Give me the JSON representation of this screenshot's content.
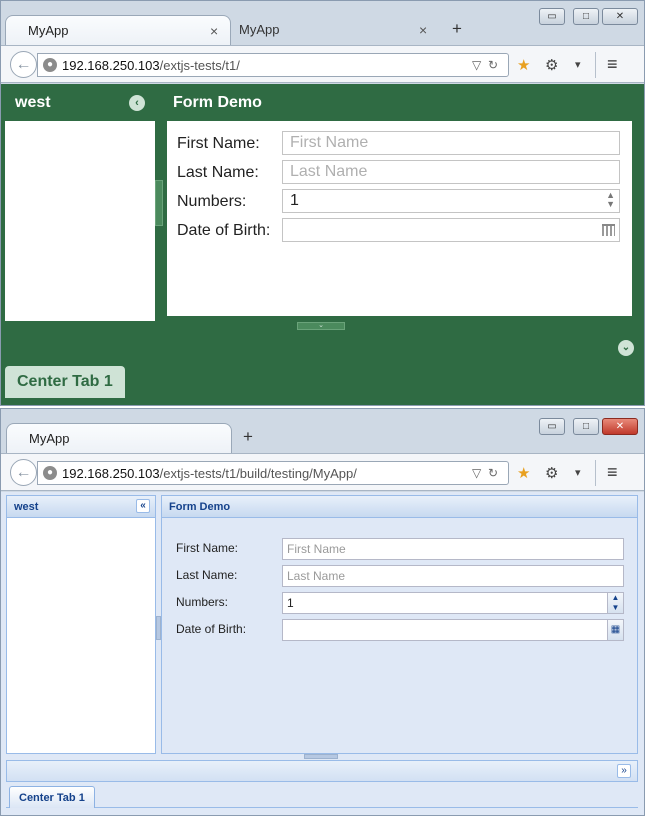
{
  "window1": {
    "tabs": [
      {
        "label": "MyApp",
        "close": "×"
      },
      {
        "label": "MyApp",
        "close": "×"
      }
    ],
    "new_tab": "+",
    "window_buttons": {
      "minimize": "▭",
      "maximize": "□",
      "close": "✕"
    },
    "url": {
      "host": "192.168.250.103",
      "path": "/extjs-tests/t1/"
    },
    "west_panel": {
      "title": "west",
      "collapse_icon": "‹"
    },
    "form_panel": {
      "title": "Form Demo",
      "fields": [
        {
          "label": "First Name:",
          "value": "",
          "placeholder": "First Name"
        },
        {
          "label": "Last Name:",
          "value": "",
          "placeholder": "Last Name"
        },
        {
          "label": "Numbers:",
          "value": "1",
          "placeholder": ""
        },
        {
          "label": "Date of Birth:",
          "value": "",
          "placeholder": ""
        }
      ]
    },
    "south_expand_icon": "⌄",
    "center_tab": "Center Tab 1",
    "colors": {
      "accent": "#2f6b43",
      "tab_bg": "#cfe3d6"
    }
  },
  "window2": {
    "tabs": [
      {
        "label": "MyApp"
      }
    ],
    "new_tab": "+",
    "window_buttons": {
      "minimize": "▭",
      "maximize": "□",
      "close": "✕"
    },
    "url": {
      "host": "192.168.250.103",
      "path": "/extjs-tests/t1/build/testing/MyApp/"
    },
    "west_panel": {
      "title": "west",
      "collapse_icon": "«"
    },
    "form_panel": {
      "title": "Form Demo",
      "fields": [
        {
          "label": "First Name:",
          "value": "",
          "placeholder": "First Name"
        },
        {
          "label": "Last Name:",
          "value": "",
          "placeholder": "Last Name"
        },
        {
          "label": "Numbers:",
          "value": "1",
          "placeholder": ""
        },
        {
          "label": "Date of Birth:",
          "value": "",
          "placeholder": ""
        }
      ]
    },
    "south_expand_icon": "»",
    "center_tab": "Center Tab 1",
    "colors": {
      "accent": "#15428b",
      "panel_bg": "#dfe8f6",
      "border": "#99bbe8"
    }
  },
  "icons": {
    "back": "←",
    "globe": "●",
    "dropdown": "▽",
    "reload": "↻",
    "bookmark": "★",
    "settings": "⚙",
    "caret": "▾",
    "menu": "≡",
    "spinner_up": "▲",
    "spinner_down": "▼"
  }
}
